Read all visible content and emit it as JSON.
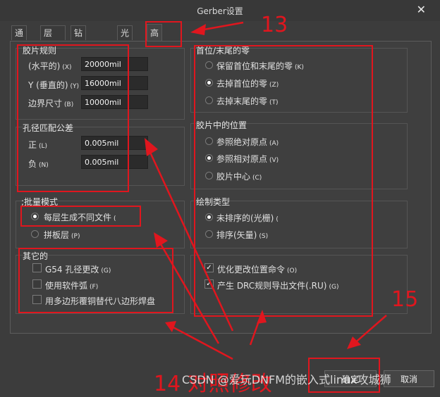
{
  "window": {
    "title": "Gerber设置",
    "close": "✕"
  },
  "tabs": [
    {
      "label": "通用"
    },
    {
      "label": "层"
    },
    {
      "label": "钻孔图层"
    },
    {
      "label": "光圈"
    },
    {
      "label": "高级"
    }
  ],
  "film_rules": {
    "title": "胶片规则",
    "rows": [
      {
        "label": "(水平的)",
        "accel": "(X)",
        "value": "20000mil"
      },
      {
        "label": "Y (垂直的)",
        "accel": "(Y)",
        "value": "16000mil"
      },
      {
        "label": "边界尺寸",
        "accel": "(B)",
        "value": "10000mil"
      }
    ]
  },
  "aperture_tolerance": {
    "title": "孔径匹配公差",
    "rows": [
      {
        "label": "正",
        "accel": "(L)",
        "value": "0.005mil"
      },
      {
        "label": "负",
        "accel": "(N)",
        "value": "0.005mil"
      }
    ]
  },
  "batch_mode": {
    "title": ";批量模式",
    "options": [
      {
        "label": "每层生成不同文件",
        "accel": "(",
        "selected": true
      },
      {
        "label": "拼板层",
        "accel": "(P)",
        "selected": false
      }
    ]
  },
  "other": {
    "title": "其它的",
    "options": [
      {
        "label": "G54 孔径更改",
        "accel": "(G)",
        "checked": false
      },
      {
        "label": "使用软件弧",
        "accel": "(F)",
        "checked": false
      },
      {
        "label": "用多边形覆铜替代八边形焊盘",
        "accel": "",
        "checked": false
      }
    ]
  },
  "leading_zeros": {
    "title": "首位/末尾的零",
    "options": [
      {
        "label": "保留首位和末尾的零",
        "accel": "(K)",
        "selected": false
      },
      {
        "label": "去掉首位的零",
        "accel": "(Z)",
        "selected": true
      },
      {
        "label": "去掉末尾的零",
        "accel": "(T)",
        "selected": false
      }
    ]
  },
  "film_position": {
    "title": "胶片中的位置",
    "options": [
      {
        "label": "参照绝对原点",
        "accel": "(A)",
        "selected": false
      },
      {
        "label": "参照相对原点",
        "accel": "(V)",
        "selected": true
      },
      {
        "label": "胶片中心",
        "accel": "(C)",
        "selected": false
      }
    ]
  },
  "plot_type": {
    "title": "绘制类型",
    "options": [
      {
        "label": "未排序的(光栅)",
        "accel": "(",
        "selected": true
      },
      {
        "label": "排序(矢量)",
        "accel": "(S)",
        "selected": false
      }
    ]
  },
  "bottom_options": [
    {
      "label": "优化更改位置命令",
      "accel": "(O)",
      "checked": true
    },
    {
      "label": "产生 DRC规则导出文件(.RU)",
      "accel": "(G)",
      "checked": true
    }
  ],
  "buttons": {
    "ok": "确定",
    "cancel": "取消"
  },
  "annotations": {
    "n13": "13",
    "n14": "14 对照修改",
    "n15": "15"
  },
  "watermark": "CSDN @爱玩DNFM的嵌入式linux攻城狮",
  "colors": {
    "annotation_red": "#e0161e",
    "background": "#3c3c3c"
  }
}
